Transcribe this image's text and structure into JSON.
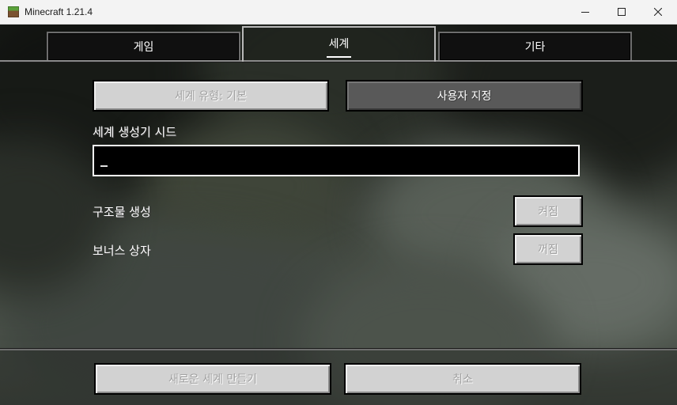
{
  "window": {
    "title": "Minecraft 1.21.4",
    "controls": [
      "minimize",
      "maximize",
      "close"
    ]
  },
  "tabs": [
    {
      "label": "게임",
      "selected": false
    },
    {
      "label": "세계",
      "selected": true
    },
    {
      "label": "기타",
      "selected": false
    }
  ],
  "world": {
    "world_type_button": "세계 유형: 기본",
    "customize_button": "사용자 지정",
    "seed_label": "세계 생성기 시드",
    "seed_value": "",
    "structures_label": "구조물 생성",
    "structures_toggle": "켜짐",
    "bonus_chest_label": "보너스 상자",
    "bonus_chest_toggle": "꺼짐"
  },
  "footer": {
    "create_button": "새로운 세계 만들기",
    "cancel_button": "취소"
  },
  "colors": {
    "button_light": "#d2d2d2",
    "button_dark": "#595959",
    "input_bg": "#000000",
    "text": "#ffffff"
  }
}
